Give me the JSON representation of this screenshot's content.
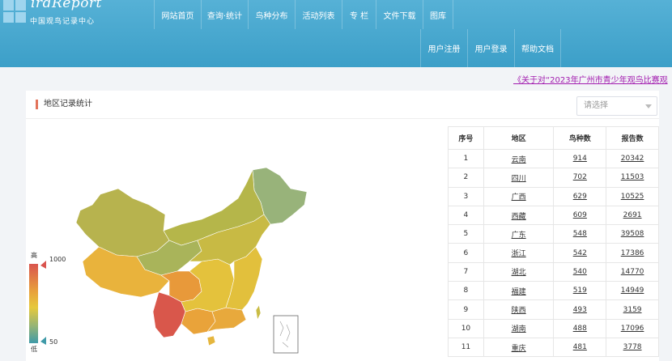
{
  "header": {
    "logo_title": "irdReport",
    "logo_sub": "中国观鸟记录中心",
    "nav_row1": [
      "网站首页",
      "查询·统计",
      "鸟种分布",
      "活动列表",
      "专 栏",
      "文件下载",
      "图库"
    ],
    "nav_row2": [
      "用户注册",
      "用户登录",
      "帮助文档"
    ]
  },
  "notice": "《关于对“2023年广州市青少年观鸟比赛观",
  "panel": {
    "title": "地区记录统计",
    "select_placeholder": "请选择"
  },
  "legend": {
    "high": "高",
    "low": "低",
    "max": "1000",
    "min": "50"
  },
  "table": {
    "headers": [
      "序号",
      "地区",
      "鸟种数",
      "报告数"
    ],
    "rows": [
      [
        "1",
        "云南",
        "914",
        "20342"
      ],
      [
        "2",
        "四川",
        "702",
        "11503"
      ],
      [
        "3",
        "广西",
        "629",
        "10525"
      ],
      [
        "4",
        "西藏",
        "609",
        "2691"
      ],
      [
        "5",
        "广东",
        "548",
        "39508"
      ],
      [
        "6",
        "浙江",
        "542",
        "17386"
      ],
      [
        "7",
        "湖北",
        "540",
        "14770"
      ],
      [
        "8",
        "福建",
        "519",
        "14949"
      ],
      [
        "9",
        "陕西",
        "493",
        "3159"
      ],
      [
        "10",
        "湖南",
        "488",
        "17096"
      ],
      [
        "11",
        "重庆",
        "481",
        "3778"
      ]
    ]
  },
  "colors": {
    "header": "#4aa8cf",
    "accent": "#e2735a",
    "notice": "#a21caf"
  }
}
